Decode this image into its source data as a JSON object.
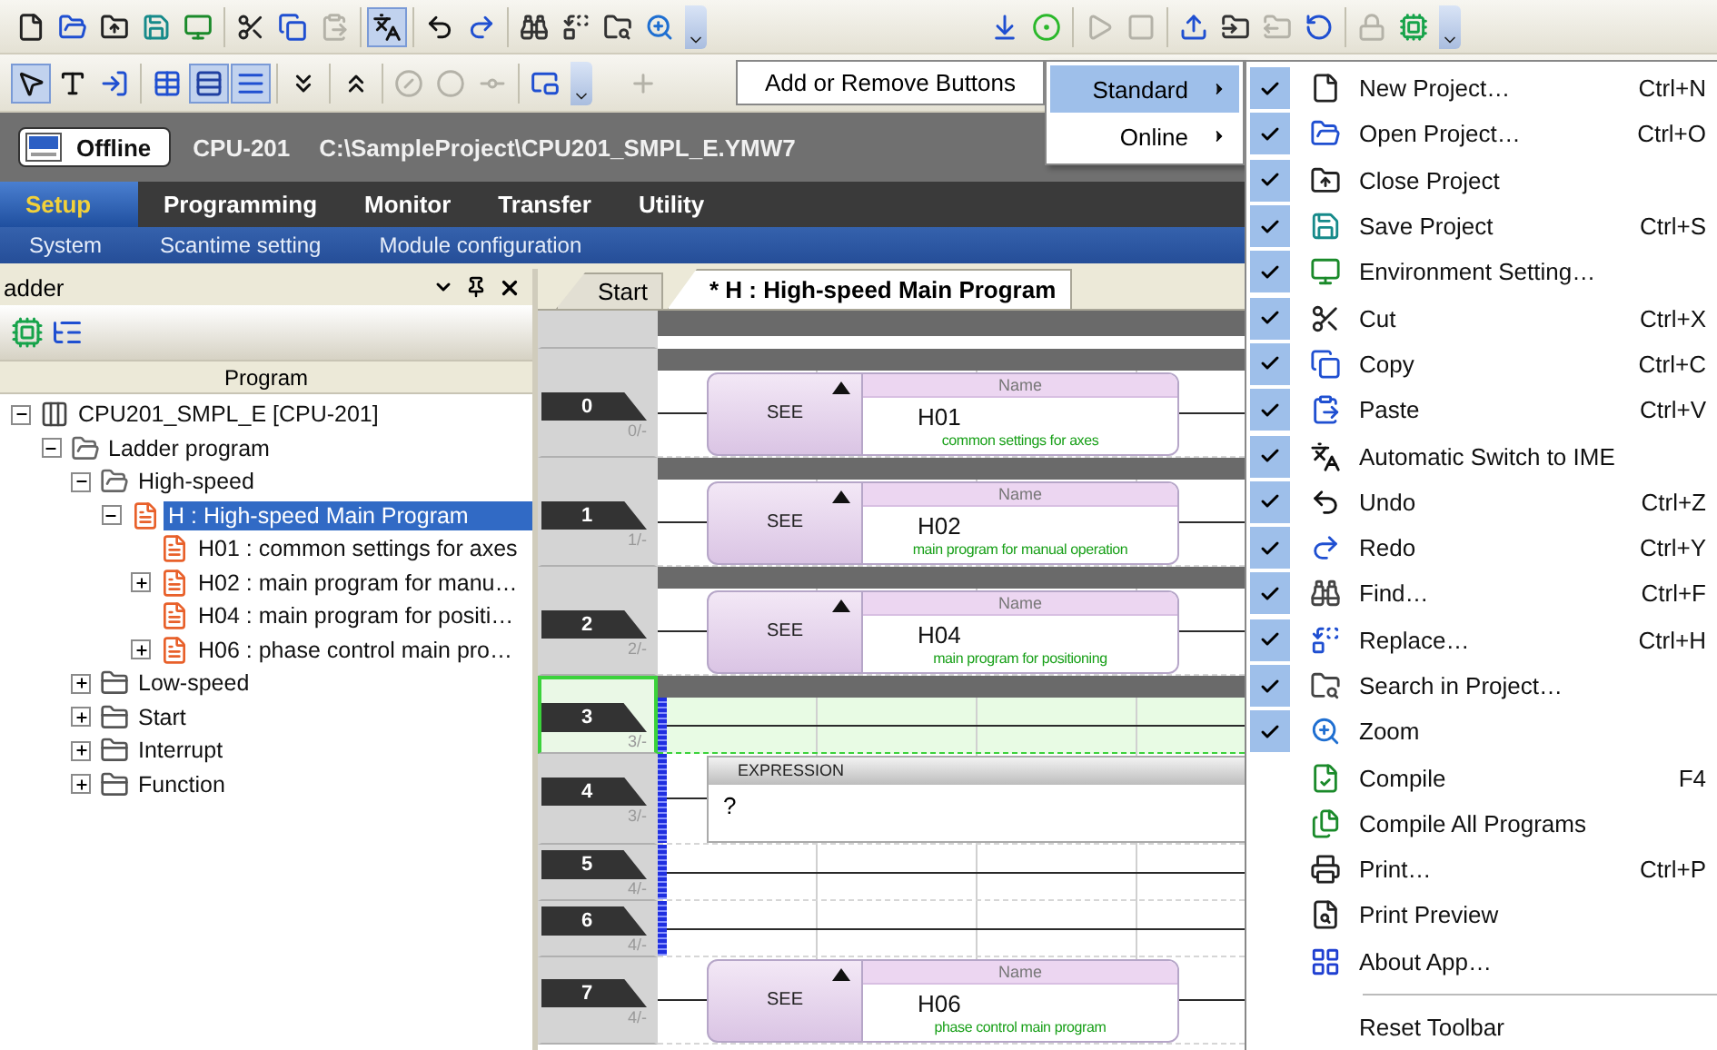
{
  "toolbars": {
    "standard": [
      [
        {
          "pressed": false,
          "disabled": false
        },
        {
          "pressed": false,
          "disabled": false
        },
        {
          "pressed": false,
          "disabled": false
        },
        {
          "pressed": false,
          "disabled": false
        },
        {
          "pressed": false,
          "disabled": false
        }
      ],
      [
        {
          "pressed": false,
          "disabled": false
        },
        {
          "pressed": false,
          "disabled": false
        },
        {
          "pressed": false,
          "disabled": true
        }
      ],
      [
        {
          "pressed": true,
          "disabled": false
        }
      ],
      [
        {
          "pressed": false,
          "disabled": false
        },
        {
          "pressed": false,
          "disabled": false
        }
      ],
      [
        {
          "pressed": false,
          "disabled": false
        },
        {
          "pressed": false,
          "disabled": false
        },
        {
          "pressed": false,
          "disabled": false
        },
        {
          "pressed": false,
          "disabled": false
        }
      ]
    ],
    "online": [
      [
        {
          "pressed": false,
          "disabled": false
        },
        {
          "pressed": false,
          "disabled": false
        }
      ],
      [
        {
          "pressed": false,
          "disabled": true
        },
        {
          "pressed": false,
          "disabled": true
        }
      ],
      [
        {
          "pressed": false,
          "disabled": false
        },
        {
          "pressed": false,
          "disabled": false
        },
        {
          "pressed": false,
          "disabled": true
        },
        {
          "pressed": false,
          "disabled": false
        }
      ],
      [
        {
          "pressed": false,
          "disabled": true
        },
        {
          "pressed": false,
          "disabled": false
        }
      ]
    ],
    "ladder": [
      [
        {
          "pressed": true,
          "disabled": false
        },
        {
          "pressed": false,
          "disabled": false
        },
        {
          "pressed": false,
          "disabled": false
        }
      ],
      [
        {
          "pressed": false,
          "disabled": false
        },
        {
          "pressed": true,
          "disabled": false
        },
        {
          "pressed": true,
          "disabled": false
        }
      ],
      [
        {
          "pressed": false,
          "disabled": false
        }
      ],
      [
        {
          "pressed": false,
          "disabled": false
        }
      ],
      [
        {
          "pressed": false,
          "disabled": true
        },
        {
          "pressed": false,
          "disabled": true
        },
        {
          "pressed": false,
          "disabled": true
        }
      ],
      [
        {
          "pressed": false,
          "disabled": false
        }
      ]
    ],
    "partial": [
      [
        {
          "pressed": false,
          "disabled": true
        }
      ]
    ]
  },
  "status_bar": {
    "mode": "Offline",
    "cpu": "CPU-201",
    "path": "C:\\SampleProject\\CPU201_SMPL_E.YMW7"
  },
  "tabs": [
    {
      "label": "Setup",
      "selected": true
    },
    {
      "label": "Programming",
      "selected": false
    },
    {
      "label": "Monitor",
      "selected": false
    },
    {
      "label": "Transfer",
      "selected": false
    },
    {
      "label": "Utility",
      "selected": false
    }
  ],
  "subtabs": [
    "System",
    "Scantime setting",
    "Module configuration"
  ],
  "panel": {
    "title": "adder",
    "column": "Program",
    "tree": [
      {
        "kind": "cpu",
        "label": "CPU201_SMPL_E [CPU-201]",
        "expanded": true,
        "selected": false,
        "children": [
          {
            "kind": "folder-open",
            "label": "Ladder program",
            "expanded": true,
            "selected": false,
            "children": [
              {
                "kind": "folder-open",
                "label": "High-speed",
                "expanded": true,
                "selected": false,
                "children": [
                  {
                    "kind": "program",
                    "label": "H : High-speed Main Program",
                    "expanded": true,
                    "selected": true,
                    "children": [
                      {
                        "kind": "program",
                        "label": "H01 : common settings for axes",
                        "selected": false
                      },
                      {
                        "kind": "program",
                        "label": "H02 : main program for manu…",
                        "expanded": false,
                        "selected": false
                      },
                      {
                        "kind": "program",
                        "label": "H04 : main program for positi…",
                        "selected": false
                      },
                      {
                        "kind": "program",
                        "label": "H06 : phase control main pro…",
                        "expanded": false,
                        "selected": false
                      }
                    ]
                  }
                ]
              },
              {
                "kind": "folder",
                "label": "Low-speed",
                "expanded": false,
                "selected": false
              },
              {
                "kind": "folder",
                "label": "Start",
                "expanded": false,
                "selected": false
              },
              {
                "kind": "folder",
                "label": "Interrupt",
                "expanded": false,
                "selected": false
              },
              {
                "kind": "folder",
                "label": "Function",
                "expanded": false,
                "selected": false
              }
            ]
          }
        ]
      }
    ]
  },
  "editor": {
    "tabs": [
      {
        "label": "Start",
        "selected": false
      },
      {
        "label": "* H : High-speed Main Program",
        "selected": true
      }
    ],
    "rungs": [
      {
        "kind": "see",
        "number": "0",
        "step": "0/-",
        "bar": true,
        "selected": false,
        "cursor": false,
        "block": "SEE",
        "header": "Name",
        "name": "H01",
        "comment": "common settings for axes"
      },
      {
        "kind": "see",
        "number": "1",
        "step": "1/-",
        "bar": true,
        "selected": false,
        "cursor": false,
        "block": "SEE",
        "header": "Name",
        "name": "H02",
        "comment": "main program for manual operation"
      },
      {
        "kind": "see",
        "number": "2",
        "step": "2/-",
        "bar": true,
        "selected": false,
        "cursor": false,
        "block": "SEE",
        "header": "Name",
        "name": "H04",
        "comment": "main program for positioning"
      },
      {
        "kind": "empty",
        "number": "3",
        "step": "3/-",
        "bar": true,
        "selected": true,
        "cursor": true
      },
      {
        "kind": "expression",
        "number": "4",
        "step": "3/-",
        "bar": false,
        "selected": false,
        "cursor": true,
        "header": "EXPRESSION",
        "text": "?"
      },
      {
        "kind": "empty",
        "number": "5",
        "step": "4/-",
        "bar": false,
        "selected": false,
        "cursor": true
      },
      {
        "kind": "empty",
        "number": "6",
        "step": "4/-",
        "bar": false,
        "selected": false,
        "cursor": true
      },
      {
        "kind": "see",
        "number": "7",
        "step": "4/-",
        "bar": false,
        "selected": false,
        "cursor": false,
        "block": "SEE",
        "header": "Name",
        "name": "H06",
        "comment": "phase control main program"
      }
    ]
  },
  "popup": {
    "label": "Add or Remove Buttons"
  },
  "submenu": [
    {
      "label": "Standard",
      "selected": true
    },
    {
      "label": "Online",
      "selected": false
    }
  ],
  "menu": {
    "items": [
      {
        "label": "New Project…",
        "shortcut": "Ctrl+N",
        "checked": true
      },
      {
        "label": "Open Project…",
        "shortcut": "Ctrl+O",
        "checked": true
      },
      {
        "label": "Close Project",
        "checked": true
      },
      {
        "label": "Save Project",
        "shortcut": "Ctrl+S",
        "checked": true
      },
      {
        "label": "Environment Setting…",
        "checked": true
      },
      {
        "label": "Cut",
        "shortcut": "Ctrl+X",
        "checked": true
      },
      {
        "label": "Copy",
        "shortcut": "Ctrl+C",
        "checked": true
      },
      {
        "label": "Paste",
        "shortcut": "Ctrl+V",
        "checked": true
      },
      {
        "label": "Automatic Switch to IME",
        "checked": true
      },
      {
        "label": "Undo",
        "shortcut": "Ctrl+Z",
        "checked": true
      },
      {
        "label": "Redo",
        "shortcut": "Ctrl+Y",
        "checked": true
      },
      {
        "label": "Find…",
        "shortcut": "Ctrl+F",
        "checked": true
      },
      {
        "label": "Replace…",
        "shortcut": "Ctrl+H",
        "checked": true
      },
      {
        "label": "Search in Project…",
        "checked": true
      },
      {
        "label": "Zoom",
        "checked": true
      },
      {
        "label": "Compile",
        "shortcut": "F4",
        "checked": false
      },
      {
        "label": "Compile All Programs",
        "checked": false
      },
      {
        "label": "Print…",
        "shortcut": "Ctrl+P",
        "checked": false
      },
      {
        "label": "Print Preview",
        "checked": false
      },
      {
        "label": "About App…",
        "checked": false
      }
    ],
    "reset": "Reset Toolbar"
  }
}
